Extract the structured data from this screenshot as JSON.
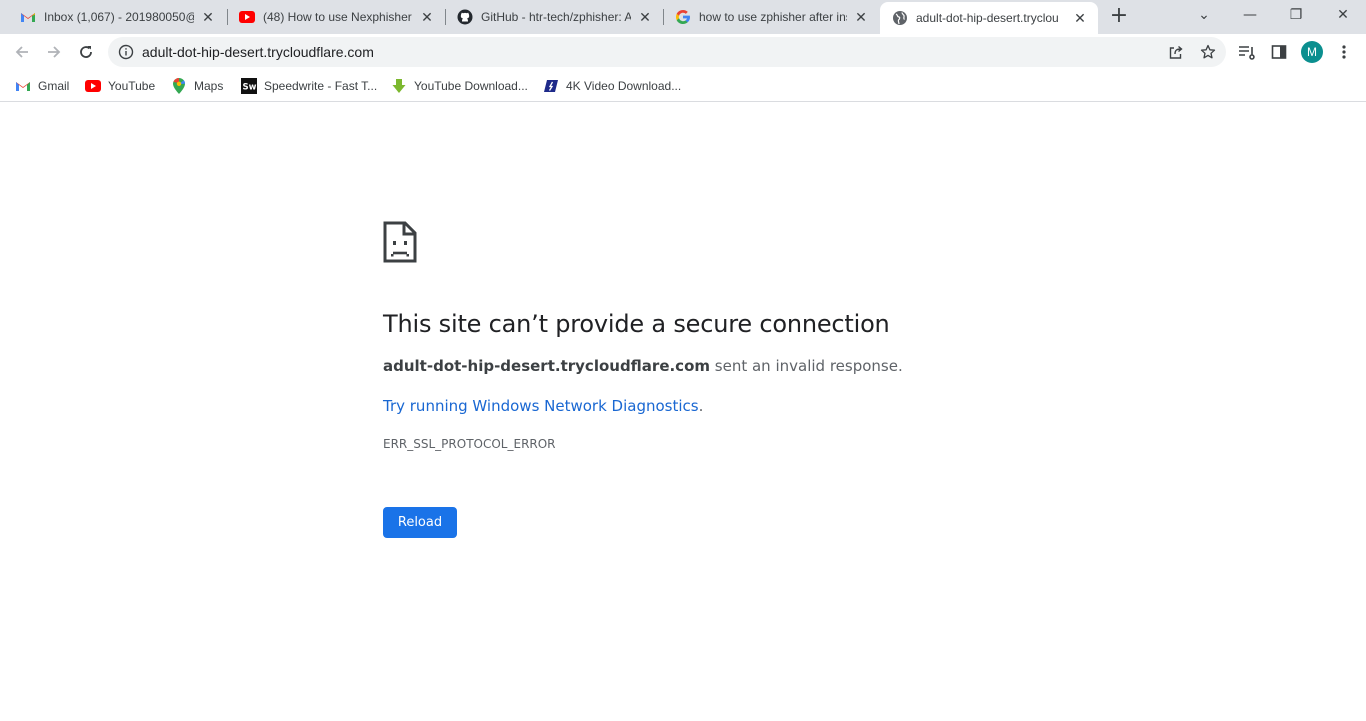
{
  "tabs": [
    {
      "title": "Inbox (1,067) - 201980050@",
      "icon": "gmail-icon"
    },
    {
      "title": "(48) How to use Nexphisher |",
      "icon": "youtube-icon"
    },
    {
      "title": "GitHub - htr-tech/zphisher: A",
      "icon": "github-icon"
    },
    {
      "title": "how to use zphisher after ins",
      "icon": "google-icon"
    },
    {
      "title": "adult-dot-hip-desert.tryclou",
      "icon": "globe-icon",
      "active": true
    }
  ],
  "tab_close_glyph": "✕",
  "new_tab_glyph": "+",
  "window_controls": {
    "tab_search": "⌄",
    "minimize": "—",
    "restore": "❐",
    "close": "✕"
  },
  "omnibox": {
    "url": "adult-dot-hip-desert.trycloudflare.com"
  },
  "profile": {
    "initial": "M",
    "color": "#0b8f8f"
  },
  "bookmarks": [
    {
      "label": "Gmail",
      "icon": "gmail-icon"
    },
    {
      "label": "YouTube",
      "icon": "youtube-icon"
    },
    {
      "label": "Maps",
      "icon": "maps-icon"
    },
    {
      "label": "Speedwrite - Fast T...",
      "icon": "speedwrite-icon"
    },
    {
      "label": "YouTube Download...",
      "icon": "download-arrow-icon"
    },
    {
      "label": "4K Video Download...",
      "icon": "4k-downloader-icon"
    }
  ],
  "error": {
    "title": "This site can’t provide a secure connection",
    "host": "adult-dot-hip-desert.trycloudflare.com",
    "message": " sent an invalid response.",
    "link": "Try running Windows Network Diagnostics",
    "link_suffix": ".",
    "code": "ERR_SSL_PROTOCOL_ERROR",
    "reload_label": "Reload"
  },
  "colors": {
    "accent": "#1a73e8",
    "link": "#1967d2",
    "tabstrip": "#dee1e6"
  }
}
